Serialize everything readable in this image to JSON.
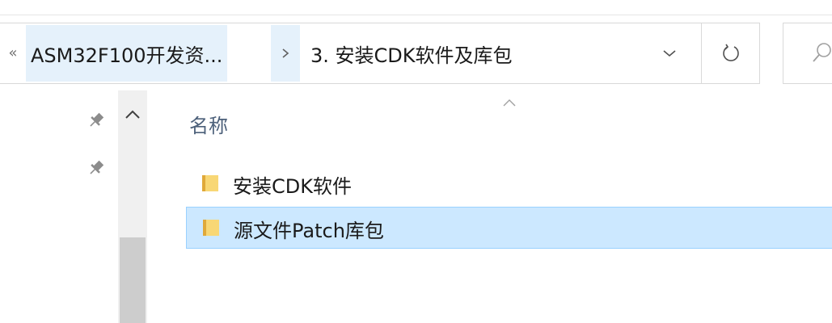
{
  "address_bar": {
    "overflow_glyph": "«",
    "breadcrumbs": [
      {
        "label": "ASM32F100开发资..."
      },
      {
        "label": "3. 安装CDK软件及库包"
      }
    ],
    "separator_icon": "chevron-right-icon",
    "dropdown_icon": "chevron-down-icon"
  },
  "toolbar": {
    "refresh_icon": "refresh-icon",
    "search_icon": "search-icon"
  },
  "nav_pane": {
    "pin_icon": "pin-icon",
    "pinned_count": 2
  },
  "file_list": {
    "column_header": "名称",
    "sort_icon": "sort-ascending-icon",
    "items": [
      {
        "name": "安装CDK软件",
        "type": "folder",
        "selected": false
      },
      {
        "name": "源文件Patch库包",
        "type": "folder",
        "selected": true
      }
    ]
  },
  "colors": {
    "selection_bg": "#cce8ff",
    "selection_border": "#99d1ff",
    "crumb_hover_bg": "#e5f1fb",
    "header_text": "#4c607a",
    "folder_yellow": "#f8d775"
  }
}
